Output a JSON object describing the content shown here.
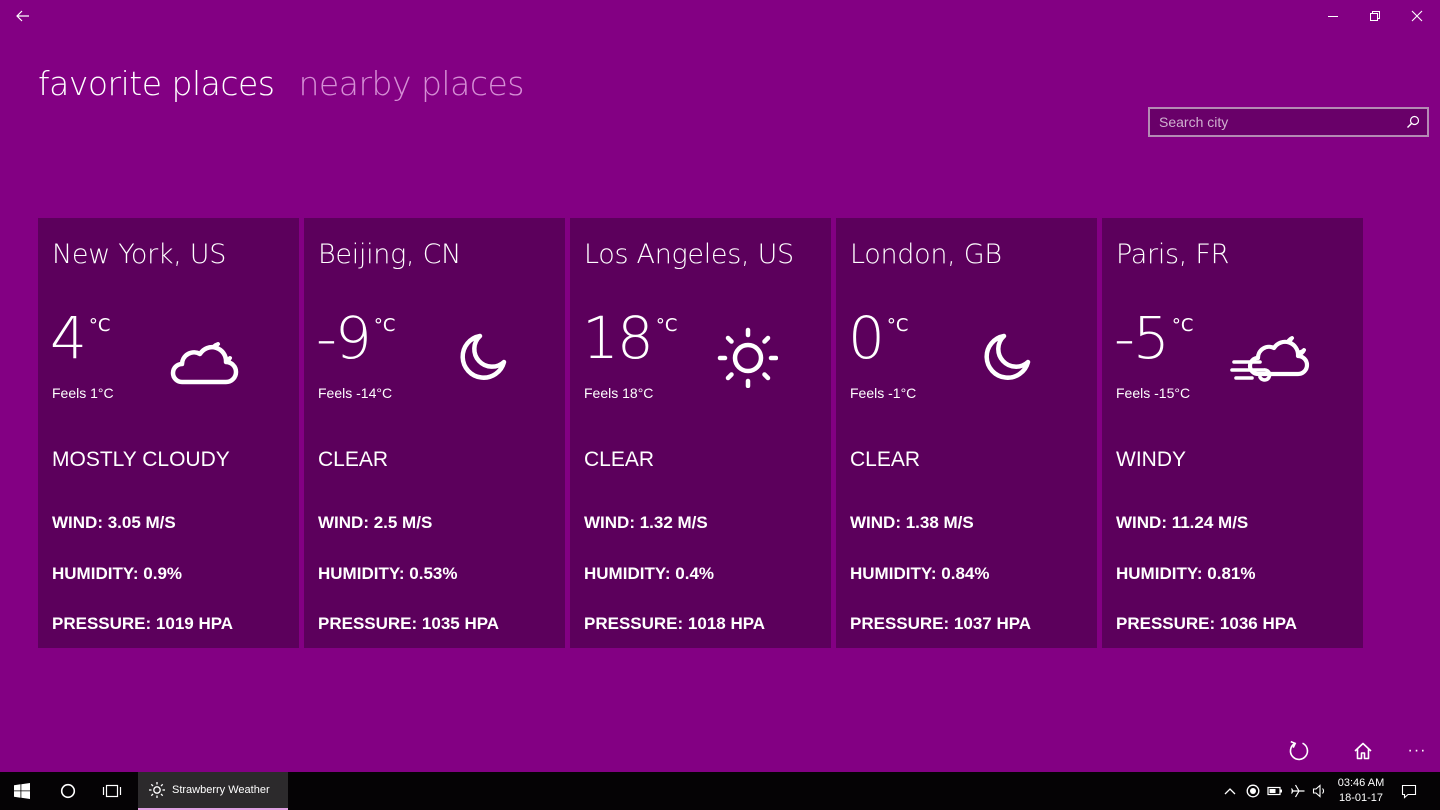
{
  "window": {
    "app_name": "Strawberry Weather"
  },
  "pivot": {
    "favorite": "favorite places",
    "nearby": "nearby places"
  },
  "search": {
    "placeholder": "Search city"
  },
  "colors": {
    "background": "#830083",
    "card": "#5c005c",
    "inactive_tab": "#d58ed5"
  },
  "cards": [
    {
      "city": "New York, US",
      "temp": "4",
      "unit": "°C",
      "feels": "Feels 1°C",
      "condition": "MOSTLY CLOUDY",
      "icon": "partly-cloudy-night-icon",
      "wind": "WIND: 3.05 M/S",
      "humidity": "HUMIDITY: 0.9%",
      "pressure": "PRESSURE: 1019 HPA"
    },
    {
      "city": "Beijing, CN",
      "temp": "-9",
      "unit": "°C",
      "feels": "Feels -14°C",
      "condition": "CLEAR",
      "icon": "moon-icon",
      "wind": "WIND: 2.5 M/S",
      "humidity": "HUMIDITY: 0.53%",
      "pressure": "PRESSURE: 1035 HPA"
    },
    {
      "city": "Los Angeles, US",
      "temp": "18",
      "unit": "°C",
      "feels": "Feels 18°C",
      "condition": "CLEAR",
      "icon": "sun-icon",
      "wind": "WIND: 1.32 M/S",
      "humidity": "HUMIDITY: 0.4%",
      "pressure": "PRESSURE: 1018 HPA"
    },
    {
      "city": "London, GB",
      "temp": "0",
      "unit": "°C",
      "feels": "Feels -1°C",
      "condition": "CLEAR",
      "icon": "moon-icon",
      "wind": "WIND: 1.38 M/S",
      "humidity": "HUMIDITY: 0.84%",
      "pressure": "PRESSURE: 1037 HPA"
    },
    {
      "city": "Paris, FR",
      "temp": "-5",
      "unit": "°C",
      "feels": "Feels -15°C",
      "condition": "WINDY",
      "icon": "windy-cloud-night-icon",
      "wind": "WIND: 11.24 M/S",
      "humidity": "HUMIDITY: 0.81%",
      "pressure": "PRESSURE: 1036 HPA"
    }
  ],
  "appbar": {
    "refresh_icon": "refresh-icon",
    "home_icon": "home-icon",
    "more_label": "···"
  },
  "taskbar": {
    "app_label": "Strawberry Weather",
    "time": "03:46 AM",
    "date": "18-01-17"
  }
}
